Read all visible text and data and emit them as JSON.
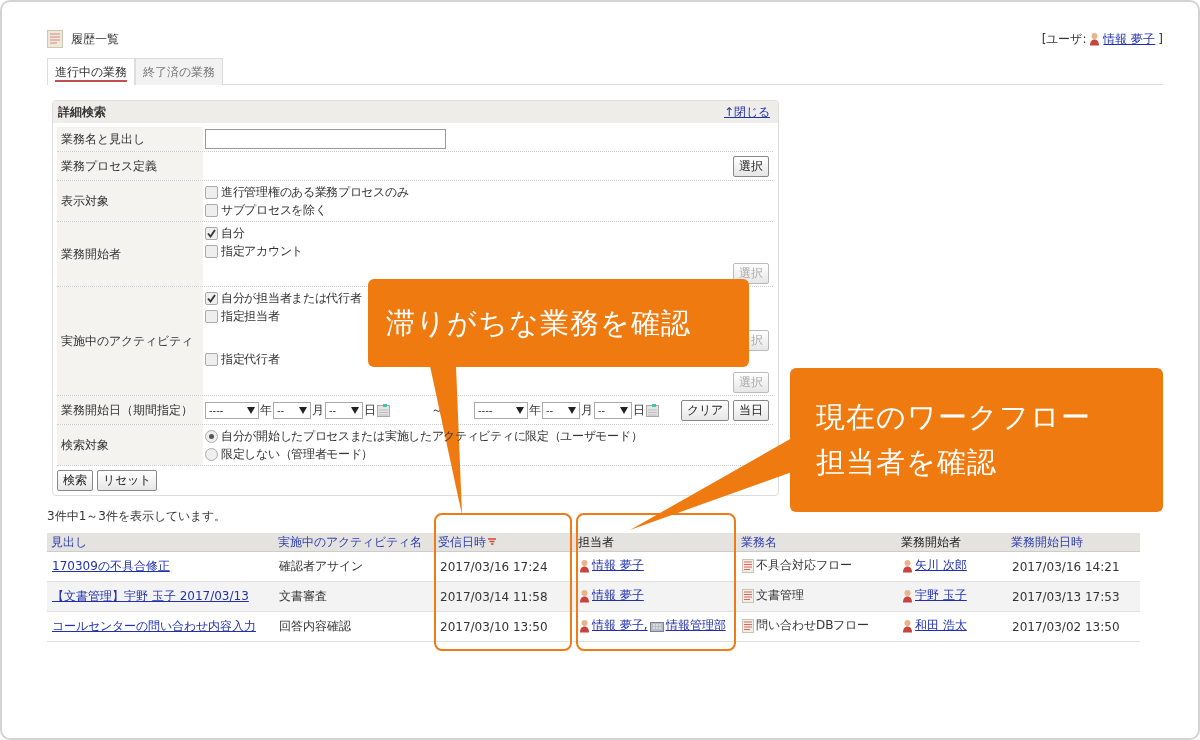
{
  "page": {
    "title": "履歴一覧",
    "user_prefix": "[ユーザ:",
    "user_name": "情報 夢子",
    "user_suffix": "]"
  },
  "tabs": [
    {
      "label": "進行中の業務",
      "selected": true
    },
    {
      "label": "終了済の業務",
      "selected": false
    }
  ],
  "search": {
    "title": "詳細検索",
    "close_link": "↑閉じる",
    "rows": [
      {
        "kind": "text",
        "label": "業務名と見出し"
      },
      {
        "kind": "select",
        "label": "業務プロセス定義",
        "button": "選択"
      },
      {
        "kind": "checks",
        "label": "表示対象",
        "items": [
          {
            "label": "進行管理権のある業務プロセスのみ",
            "checked": false
          },
          {
            "label": "サブプロセスを除く",
            "checked": false
          }
        ]
      },
      {
        "kind": "checks",
        "label": "業務開始者",
        "items": [
          {
            "label": "自分",
            "checked": true
          },
          {
            "label": "指定アカウント",
            "checked": false,
            "button": {
              "label": "選択",
              "disabled": true
            }
          }
        ]
      },
      {
        "kind": "checks",
        "label": "実施中のアクティビティ",
        "items": [
          {
            "label": "自分が担当者または代行者",
            "checked": true
          },
          {
            "label": "指定担当者",
            "checked": false,
            "button": {
              "label": "択",
              "disabled": true
            }
          },
          {
            "label": "指定代行者",
            "checked": false,
            "button": {
              "label": "選択",
              "disabled": true
            }
          }
        ]
      },
      {
        "kind": "date",
        "label": "業務開始日（期間指定）",
        "ranges": [
          {
            "year": "----",
            "year_unit": "年",
            "month": "--",
            "month_unit": "月",
            "day": "--",
            "day_unit": "日"
          },
          {
            "year": "----",
            "year_unit": "年",
            "month": "--",
            "month_unit": "月",
            "day": "--",
            "day_unit": "日"
          }
        ],
        "separator": "～",
        "buttons": [
          "クリア",
          "当日"
        ]
      },
      {
        "kind": "radios",
        "label": "検索対象",
        "items": [
          {
            "label": "自分が開始したプロセスまたは実施したアクティビティに限定（ユーザモード）",
            "selected": true
          },
          {
            "label": "限定しない（管理者モード）",
            "selected": false
          }
        ]
      }
    ],
    "buttons": [
      "検索",
      "リセット"
    ]
  },
  "result_count": "3件中1～3件を表示しています。",
  "table": {
    "columns": [
      {
        "label": "見出し",
        "sortable": true,
        "sorted": false
      },
      {
        "label": "実施中のアクティビティ名",
        "sortable": true,
        "sorted": false
      },
      {
        "label": "受信日時",
        "sortable": true,
        "sorted": true
      },
      {
        "label": "担当者",
        "sortable": false,
        "sorted": false
      },
      {
        "label": "業務名",
        "sortable": true,
        "sorted": false
      },
      {
        "label": "業務開始者",
        "sortable": false,
        "sorted": false
      },
      {
        "label": "業務開始日時",
        "sortable": true,
        "sorted": false
      }
    ],
    "rows": [
      {
        "title": "170309の不具合修正",
        "activity": "確認者アサイン",
        "received": "2017/03/16 17:24",
        "assignees": [
          {
            "kind": "person",
            "name": "情報 夢子"
          }
        ],
        "process": "不具合対応フロー",
        "starter": "矢川 次郎",
        "started": "2017/03/16 14:21"
      },
      {
        "title": "【文書管理】宇野 玉子 2017/03/13",
        "activity": "文書審査",
        "received": "2017/03/14 11:58",
        "assignees": [
          {
            "kind": "person",
            "name": "情報 夢子"
          }
        ],
        "process": "文書管理",
        "starter": "宇野 玉子",
        "started": "2017/03/13 17:53"
      },
      {
        "title": "コールセンターの問い合わせ内容入力",
        "activity": "回答内容確認",
        "received": "2017/03/10 13:50",
        "assignees": [
          {
            "kind": "person",
            "name": "情報 夢子,"
          },
          {
            "kind": "group",
            "name": "情報管理部"
          }
        ],
        "process": "問い合わせDBフロー",
        "starter": "和田 浩太",
        "started": "2017/03/02 13:50"
      }
    ]
  },
  "callouts": [
    {
      "lines": [
        "滞りがちな業務を確認"
      ]
    },
    {
      "lines": [
        "現在のワークフロー",
        "担当者を確認"
      ]
    }
  ]
}
